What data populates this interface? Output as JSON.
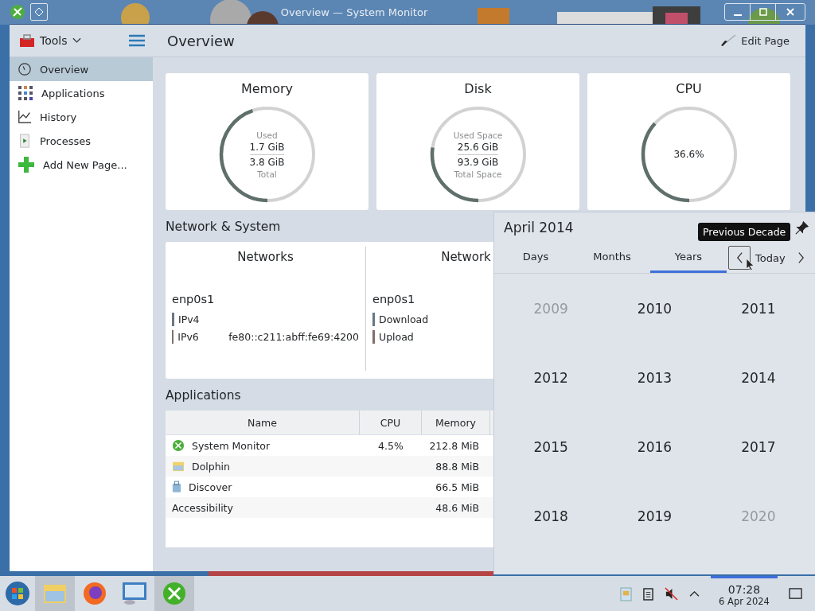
{
  "window": {
    "title": "Overview — System Monitor"
  },
  "sidebar": {
    "header": {
      "label": "Tools"
    },
    "items": [
      {
        "label": "Overview",
        "kind": "gauge",
        "selected": true
      },
      {
        "label": "Applications",
        "kind": "apps",
        "selected": false
      },
      {
        "label": "History",
        "kind": "history",
        "selected": false
      },
      {
        "label": "Processes",
        "kind": "processes",
        "selected": false
      },
      {
        "label": "Add New Page...",
        "kind": "add",
        "selected": false
      }
    ]
  },
  "page": {
    "title": "Overview",
    "edit_button": "Edit Page"
  },
  "gauges": [
    {
      "kind": "ratio",
      "title": "Memory",
      "top_label": "Used",
      "value": "1.7 GiB",
      "total": "3.8 GiB",
      "bottom_label": "Total",
      "level": 0.447
    },
    {
      "kind": "ratio",
      "title": "Disk",
      "top_label": "Used Space",
      "value": "25.6 GiB",
      "total": "93.9 GiB",
      "bottom_label": "Total Space",
      "level": 0.273
    },
    {
      "kind": "percent",
      "title": "CPU",
      "value": "36.6%",
      "level": 0.366
    }
  ],
  "network_section": {
    "title": "Network & System",
    "panels": [
      {
        "title": "Networks",
        "interface": "enp0s1",
        "rows": [
          {
            "label": "IPv4",
            "color": "#6b7682"
          },
          {
            "label": "IPv6",
            "value": "fe80::c211:abff:fe69:4200",
            "color": "#7f6f6c"
          }
        ]
      },
      {
        "title": "Network",
        "interface": "enp0s1",
        "rows": [
          {
            "label": "Download",
            "color": "#6b7682"
          },
          {
            "label": "Upload",
            "color": "#7f6f6c"
          }
        ]
      }
    ]
  },
  "applications": {
    "title": "Applications",
    "columns": [
      "Name",
      "CPU",
      "Memory"
    ],
    "rows": [
      {
        "kind": "monitor",
        "name": "System Monitor",
        "cpu": "4.5%",
        "memory": "212.8 MiB"
      },
      {
        "kind": "folder",
        "name": "Dolphin",
        "memory": "88.8 MiB"
      },
      {
        "kind": "discover",
        "name": "Discover",
        "memory": "66.5 MiB"
      },
      {
        "kind": "plain",
        "name": "Accessibility",
        "memory": "48.6 MiB"
      }
    ]
  },
  "calendar": {
    "title": "April 2014",
    "tooltip": "Previous Decade",
    "tabs": [
      {
        "label": "Days",
        "selected": false
      },
      {
        "label": "Months",
        "selected": false
      },
      {
        "label": "Years",
        "selected": true
      }
    ],
    "today": "Today",
    "years": [
      {
        "label": "2009",
        "dimmed": true
      },
      {
        "label": "2010",
        "dimmed": false
      },
      {
        "label": "2011",
        "dimmed": false
      },
      {
        "label": "2012",
        "dimmed": false
      },
      {
        "label": "2013",
        "dimmed": false
      },
      {
        "label": "2014",
        "dimmed": false
      },
      {
        "label": "2015",
        "dimmed": false
      },
      {
        "label": "2016",
        "dimmed": false
      },
      {
        "label": "2017",
        "dimmed": false
      },
      {
        "label": "2018",
        "dimmed": false
      },
      {
        "label": "2019",
        "dimmed": false
      },
      {
        "label": "2020",
        "dimmed": true
      }
    ]
  },
  "taskbar": {
    "tasks": [
      {
        "kind": "folder",
        "selected": true
      },
      {
        "kind": "firefox",
        "selected": false
      },
      {
        "kind": "remote",
        "selected": false
      },
      {
        "kind": "monitor",
        "selected": true
      }
    ],
    "clock": {
      "time": "07:28",
      "date": "6 Apr 2024",
      "selected": true
    }
  }
}
